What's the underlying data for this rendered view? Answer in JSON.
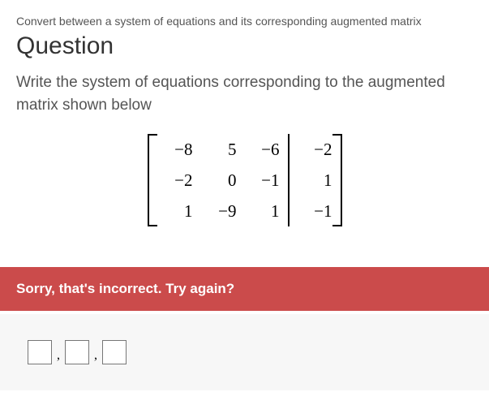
{
  "topic": "Convert between a system of equations and its corresponding augmented matrix",
  "heading": "Question",
  "prompt": "Write the system of equations corresponding to the augmented matrix shown below",
  "matrix": {
    "r1": {
      "c1": "−8",
      "c2": "5",
      "c3": "−6",
      "aug": "−2"
    },
    "r2": {
      "c1": "−2",
      "c2": "0",
      "c3": "−1",
      "aug": "1"
    },
    "r3": {
      "c1": "1",
      "c2": "−9",
      "c3": "1",
      "aug": "−1"
    }
  },
  "feedback": "Sorry, that's incorrect. Try again?",
  "sep": ","
}
